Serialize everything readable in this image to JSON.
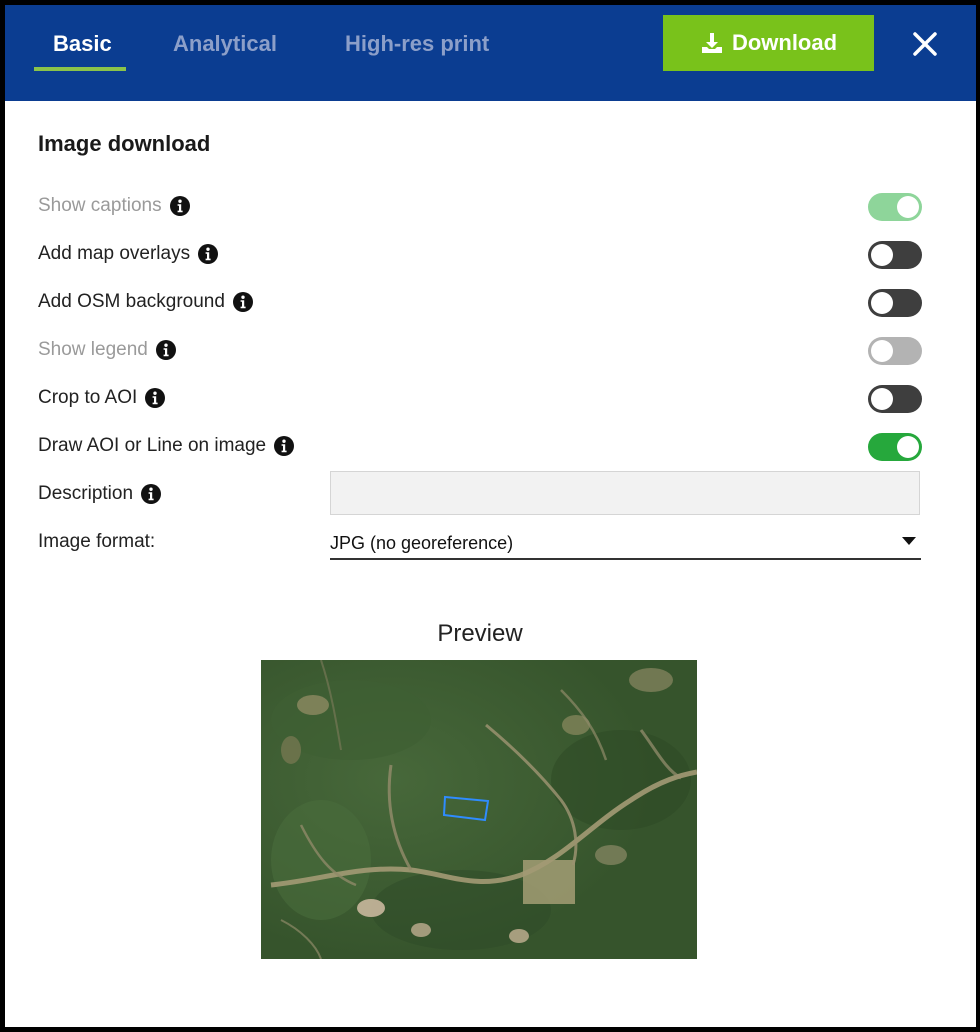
{
  "tabs": [
    {
      "label": "Basic",
      "active": true
    },
    {
      "label": "Analytical",
      "active": false
    },
    {
      "label": "High-res print",
      "active": false
    }
  ],
  "header": {
    "download_label": "Download",
    "background_color": "#0b3d91",
    "download_color": "#79c21b"
  },
  "section": {
    "title": "Image download"
  },
  "options": [
    {
      "label": "Show captions",
      "state": "on",
      "disabled": true
    },
    {
      "label": "Add map overlays",
      "state": "off",
      "disabled": false
    },
    {
      "label": "Add OSM background",
      "state": "off",
      "disabled": false
    },
    {
      "label": "Show legend",
      "state": "off",
      "disabled": true
    },
    {
      "label": "Crop to AOI",
      "state": "off",
      "disabled": false
    },
    {
      "label": "Draw AOI or Line on image",
      "state": "on",
      "disabled": false
    }
  ],
  "description": {
    "label": "Description",
    "value": "",
    "placeholder": ""
  },
  "format": {
    "label": "Image format:",
    "selected": "JPG (no georeference)"
  },
  "preview": {
    "title": "Preview",
    "aoi_color": "#2f8cff"
  },
  "icons": {
    "info": "info-icon",
    "download": "download-icon",
    "close": "close-icon",
    "dropdown": "caret-down-icon"
  }
}
